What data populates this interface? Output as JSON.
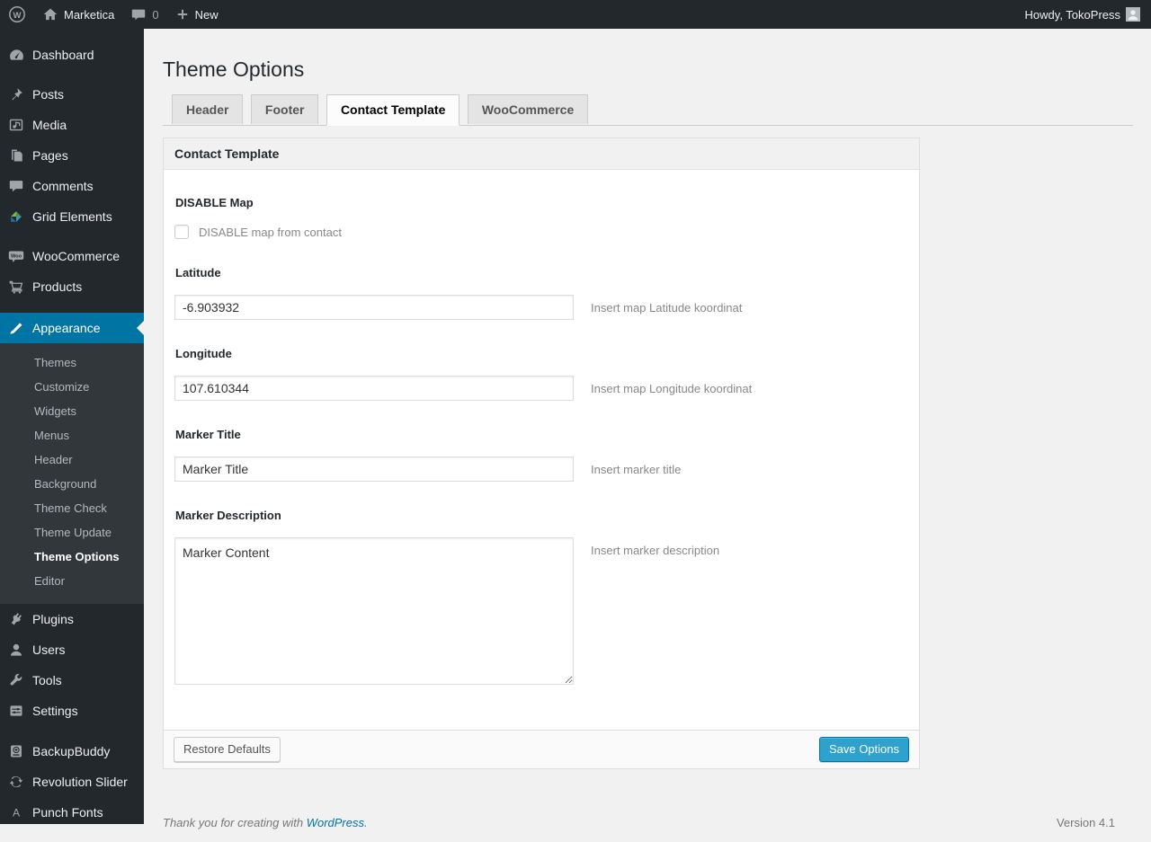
{
  "admin_bar": {
    "site_name": "Marketica",
    "comment_count": "0",
    "new_label": "New",
    "howdy": "Howdy, TokoPress"
  },
  "sidebar": {
    "items": [
      {
        "label": "Dashboard"
      },
      {
        "label": "Posts"
      },
      {
        "label": "Media"
      },
      {
        "label": "Pages"
      },
      {
        "label": "Comments"
      },
      {
        "label": "Grid Elements"
      },
      {
        "label": "WooCommerce"
      },
      {
        "label": "Products"
      },
      {
        "label": "Appearance"
      },
      {
        "label": "Plugins"
      },
      {
        "label": "Users"
      },
      {
        "label": "Tools"
      },
      {
        "label": "Settings"
      },
      {
        "label": "BackupBuddy"
      },
      {
        "label": "Revolution Slider"
      },
      {
        "label": "Punch Fonts"
      }
    ],
    "appearance_submenu": [
      {
        "label": "Themes"
      },
      {
        "label": "Customize"
      },
      {
        "label": "Widgets"
      },
      {
        "label": "Menus"
      },
      {
        "label": "Header"
      },
      {
        "label": "Background"
      },
      {
        "label": "Theme Check"
      },
      {
        "label": "Theme Update"
      },
      {
        "label": "Theme Options"
      },
      {
        "label": "Editor"
      }
    ]
  },
  "page": {
    "title": "Theme Options",
    "tabs": [
      {
        "label": "Header",
        "active": false
      },
      {
        "label": "Footer",
        "active": false
      },
      {
        "label": "Contact Template",
        "active": true
      },
      {
        "label": "WooCommerce",
        "active": false
      }
    ],
    "panel_title": "Contact Template",
    "fields": {
      "disable_map": {
        "label": "DISABLE Map",
        "checkbox_label": "DISABLE map from contact",
        "checked": false
      },
      "latitude": {
        "label": "Latitude",
        "value": "-6.903932",
        "desc": "Insert map Latitude koordinat"
      },
      "longitude": {
        "label": "Longitude",
        "value": "107.610344",
        "desc": "Insert map Longitude koordinat"
      },
      "marker_title": {
        "label": "Marker Title",
        "value": "Marker Title",
        "desc": "Insert marker title"
      },
      "marker_description": {
        "label": "Marker Description",
        "value": "Marker Content",
        "desc": "Insert marker description"
      }
    },
    "restore_label": "Restore Defaults",
    "save_label": "Save Options"
  },
  "footer": {
    "thanks_prefix": "Thank you for creating with ",
    "thanks_link": "WordPress",
    "thanks_suffix": ".",
    "version": "Version 4.1"
  },
  "colors": {
    "accent_blue": "#0074a2",
    "button_primary": "#2ea2cc",
    "admin_dark": "#23282d",
    "submenu_dark": "#32373c",
    "page_bg": "#f1f1f1"
  }
}
